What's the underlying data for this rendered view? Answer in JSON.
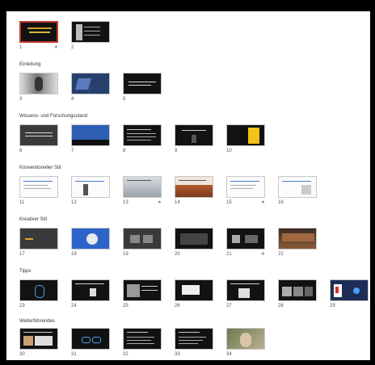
{
  "sections": [
    {
      "title": "",
      "slides": [
        {
          "num": "1",
          "star": "★"
        },
        {
          "num": "2",
          "star": ""
        }
      ]
    },
    {
      "title": "Einleitung",
      "slides": [
        {
          "num": "3",
          "star": ""
        },
        {
          "num": "4",
          "star": ""
        },
        {
          "num": "5",
          "star": ""
        }
      ]
    },
    {
      "title": "Wissens- und Forschungsstand",
      "slides": [
        {
          "num": "6",
          "star": ""
        },
        {
          "num": "7",
          "star": ""
        },
        {
          "num": "8",
          "star": ""
        },
        {
          "num": "9",
          "star": ""
        },
        {
          "num": "10",
          "star": ""
        }
      ]
    },
    {
      "title": "Konventioneller Stil",
      "slides": [
        {
          "num": "11",
          "star": ""
        },
        {
          "num": "12",
          "star": ""
        },
        {
          "num": "13",
          "star": "★"
        },
        {
          "num": "14",
          "star": ""
        },
        {
          "num": "15",
          "star": "★"
        },
        {
          "num": "16",
          "star": ""
        }
      ]
    },
    {
      "title": "Kreativer Stil",
      "slides": [
        {
          "num": "17",
          "star": ""
        },
        {
          "num": "18",
          "star": ""
        },
        {
          "num": "19",
          "star": ""
        },
        {
          "num": "20",
          "star": ""
        },
        {
          "num": "21",
          "star": "★"
        },
        {
          "num": "22",
          "star": ""
        }
      ]
    },
    {
      "title": "Tipps",
      "slides": [
        {
          "num": "23",
          "star": ""
        },
        {
          "num": "24",
          "star": ""
        },
        {
          "num": "25",
          "star": ""
        },
        {
          "num": "26",
          "star": ""
        },
        {
          "num": "27",
          "star": ""
        },
        {
          "num": "28",
          "star": ""
        },
        {
          "num": "29",
          "star": ""
        }
      ]
    },
    {
      "title": "Weiterführendes",
      "slides": [
        {
          "num": "30",
          "star": ""
        },
        {
          "num": "31",
          "star": ""
        },
        {
          "num": "32",
          "star": ""
        },
        {
          "num": "33",
          "star": ""
        },
        {
          "num": "34",
          "star": ""
        }
      ]
    }
  ]
}
